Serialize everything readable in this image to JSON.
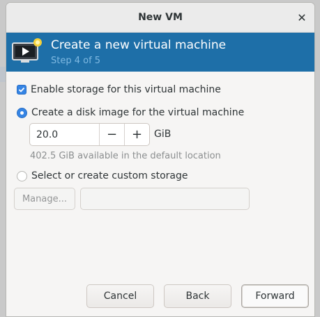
{
  "window": {
    "title": "New VM"
  },
  "header": {
    "title": "Create a new virtual machine",
    "step": "Step 4 of 5"
  },
  "storage": {
    "enable_label": "Enable storage for this virtual machine",
    "enable_checked": true,
    "disk_image_label": "Create a disk image for the virtual machine",
    "disk_size": "20.0",
    "unit": "GiB",
    "available": "402.5 GiB available in the default location",
    "custom_label": "Select or create custom storage",
    "manage_label": "Manage...",
    "custom_path": ""
  },
  "buttons": {
    "cancel": "Cancel",
    "back": "Back",
    "forward": "Forward"
  },
  "icons": {
    "close": "close-icon",
    "header": "vm-monitor-icon",
    "minus": "minus-icon",
    "plus": "plus-icon"
  },
  "colors": {
    "header_bg": "#1e6fa8",
    "accent": "#3584e4"
  }
}
